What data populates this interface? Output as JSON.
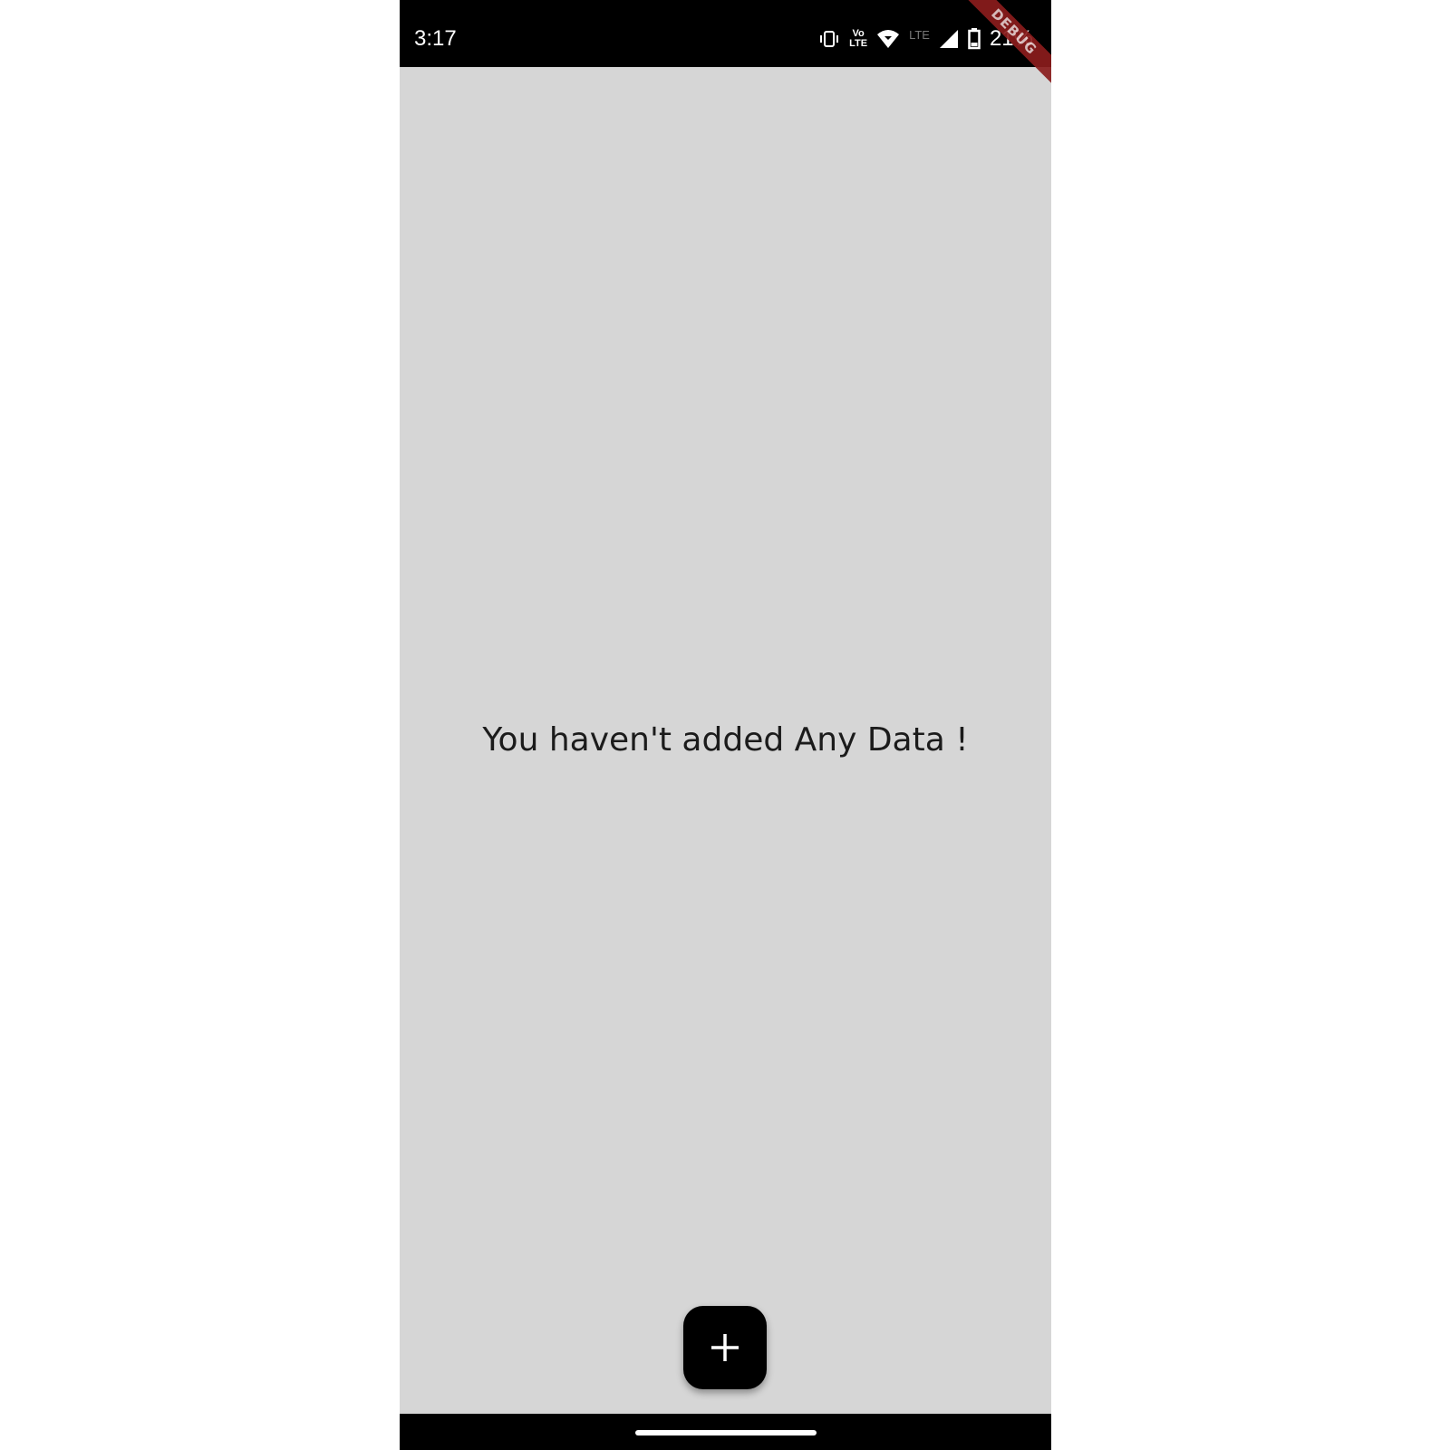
{
  "status_bar": {
    "time": "3:17",
    "volte_top": "Vo",
    "volte_bottom": "LTE",
    "network_label": "LTE",
    "battery_percent": "21%",
    "icons": [
      "vibrate-icon",
      "volte-icon",
      "wifi-icon",
      "cell-signal-icon",
      "battery-icon"
    ]
  },
  "debug_banner": {
    "label": "DEBUG",
    "color": "#8b1d1d"
  },
  "main": {
    "empty_message": "You haven't added Any Data !",
    "background": "#d6d6d6"
  },
  "fab": {
    "icon": "plus-icon",
    "color": "#000000"
  }
}
